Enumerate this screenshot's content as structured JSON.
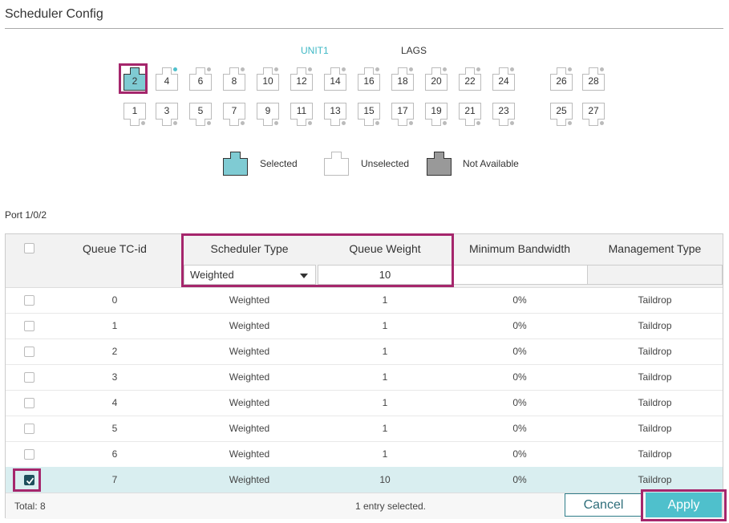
{
  "page": {
    "title": "Scheduler Config"
  },
  "panel": {
    "unit_label": "UNIT1",
    "lags_label": "LAGS",
    "top_ports": [
      "2",
      "4",
      "6",
      "8",
      "10",
      "12",
      "14",
      "16",
      "18",
      "20",
      "22",
      "24"
    ],
    "bottom_ports": [
      "1",
      "3",
      "5",
      "7",
      "9",
      "11",
      "13",
      "15",
      "17",
      "19",
      "21",
      "23"
    ],
    "lag_top": [
      "26",
      "28"
    ],
    "lag_bottom": [
      "25",
      "27"
    ],
    "selected_port": "2"
  },
  "legend": {
    "selected": "Selected",
    "unselected": "Unselected",
    "not_available": "Not Available"
  },
  "port_label": "Port 1/0/2",
  "table": {
    "headers": {
      "tc_id": "Queue TC-id",
      "scheduler_type": "Scheduler Type",
      "queue_weight": "Queue Weight",
      "min_bandwidth": "Minimum Bandwidth",
      "management_type": "Management Type"
    },
    "filter": {
      "scheduler_type": "Weighted",
      "queue_weight": "10"
    },
    "rows": [
      {
        "tc": "0",
        "type": "Weighted",
        "weight": "1",
        "bw": "0%",
        "mgmt": "Taildrop",
        "checked": false
      },
      {
        "tc": "1",
        "type": "Weighted",
        "weight": "1",
        "bw": "0%",
        "mgmt": "Taildrop",
        "checked": false
      },
      {
        "tc": "2",
        "type": "Weighted",
        "weight": "1",
        "bw": "0%",
        "mgmt": "Taildrop",
        "checked": false
      },
      {
        "tc": "3",
        "type": "Weighted",
        "weight": "1",
        "bw": "0%",
        "mgmt": "Taildrop",
        "checked": false
      },
      {
        "tc": "4",
        "type": "Weighted",
        "weight": "1",
        "bw": "0%",
        "mgmt": "Taildrop",
        "checked": false
      },
      {
        "tc": "5",
        "type": "Weighted",
        "weight": "1",
        "bw": "0%",
        "mgmt": "Taildrop",
        "checked": false
      },
      {
        "tc": "6",
        "type": "Weighted",
        "weight": "1",
        "bw": "0%",
        "mgmt": "Taildrop",
        "checked": false
      },
      {
        "tc": "7",
        "type": "Weighted",
        "weight": "10",
        "bw": "0%",
        "mgmt": "Taildrop",
        "checked": true
      }
    ],
    "footer": {
      "total": "Total: 8",
      "selection": "1 entry selected."
    }
  },
  "buttons": {
    "cancel": "Cancel",
    "apply": "Apply"
  },
  "colors": {
    "accent": "#4fc0cc",
    "highlight": "#a5266c",
    "selected_row": "#d9eef0",
    "checkbox": "#1d4f5c"
  },
  "icons": {
    "port": "ethernet-port-icon",
    "check": "check-icon",
    "dropdown": "chevron-down-icon"
  }
}
